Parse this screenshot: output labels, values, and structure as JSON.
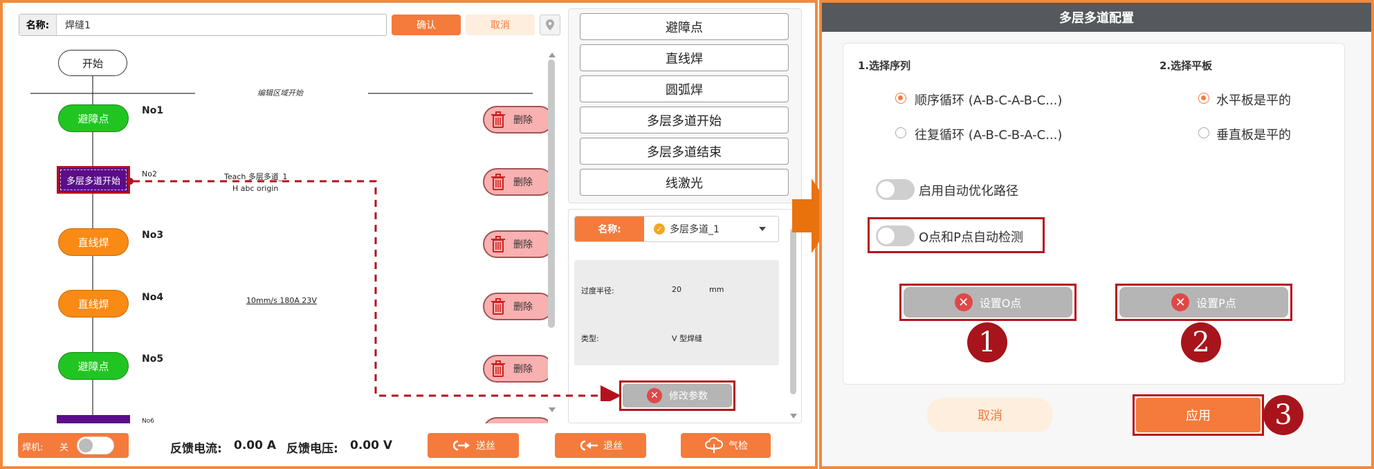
{
  "left": {
    "name_label": "名称:",
    "name_value": "焊缝1",
    "confirm": "确认",
    "cancel": "取消",
    "start": "开始",
    "edit_area_start": "编辑区域开始",
    "nodes": [
      {
        "label": "避障点",
        "no": "No1",
        "color": "green"
      },
      {
        "label": "多层多道开始",
        "no": "No2",
        "color": "purple"
      },
      {
        "label": "直线焊",
        "no": "No3",
        "color": "orange"
      },
      {
        "label": "直线焊",
        "no": "No4",
        "color": "orange"
      },
      {
        "label": "避障点",
        "no": "No5",
        "color": "green"
      },
      {
        "label": "",
        "no": "No6",
        "color": "purple"
      }
    ],
    "no2_info_line1": "Teach 多层多道_1",
    "no2_info_line2": "H abc origin",
    "no4_info": "10mm/s 180A 23V",
    "delete": "删除",
    "library": [
      "避障点",
      "直线焊",
      "圆弧焊",
      "多层多道开始",
      "多层多道结束",
      "线激光"
    ],
    "param_name_label": "名称:",
    "param_name_value": "多层多道_1",
    "transition_radius_label": "过度半径:",
    "transition_radius_value": "20",
    "transition_radius_unit": "mm",
    "type_label": "类型:",
    "type_value": "V 型焊缝",
    "modify_params": "修改参数",
    "welder_label": "焊机:",
    "welder_state": "关",
    "current_label": "反馈电流:",
    "current_value": "0.00 A",
    "voltage_label": "反馈电压:",
    "voltage_value": "0.00 V",
    "feed_wire": "送丝",
    "retract_wire": "退丝",
    "gas_check": "气检"
  },
  "right": {
    "title": "多层多道配置",
    "seq_title": "1.选择序列",
    "plate_title": "2.选择平板",
    "seq_options": [
      "顺序循环 (A-B-C-A-B-C...)",
      "往复循环 (A-B-C-B-A-C...)"
    ],
    "plate_options": [
      "水平板是平的",
      "垂直板是平的"
    ],
    "auto_path": "启用自动优化路径",
    "op_detect": "O点和P点自动检测",
    "set_o": "设置O点",
    "set_p": "设置P点",
    "cancel": "取消",
    "apply": "应用",
    "callouts": [
      "1",
      "2",
      "3"
    ]
  },
  "colors": {
    "accent": "#f47b3c",
    "highlight": "#b5111c",
    "node_purple": "#5b0d8a"
  }
}
